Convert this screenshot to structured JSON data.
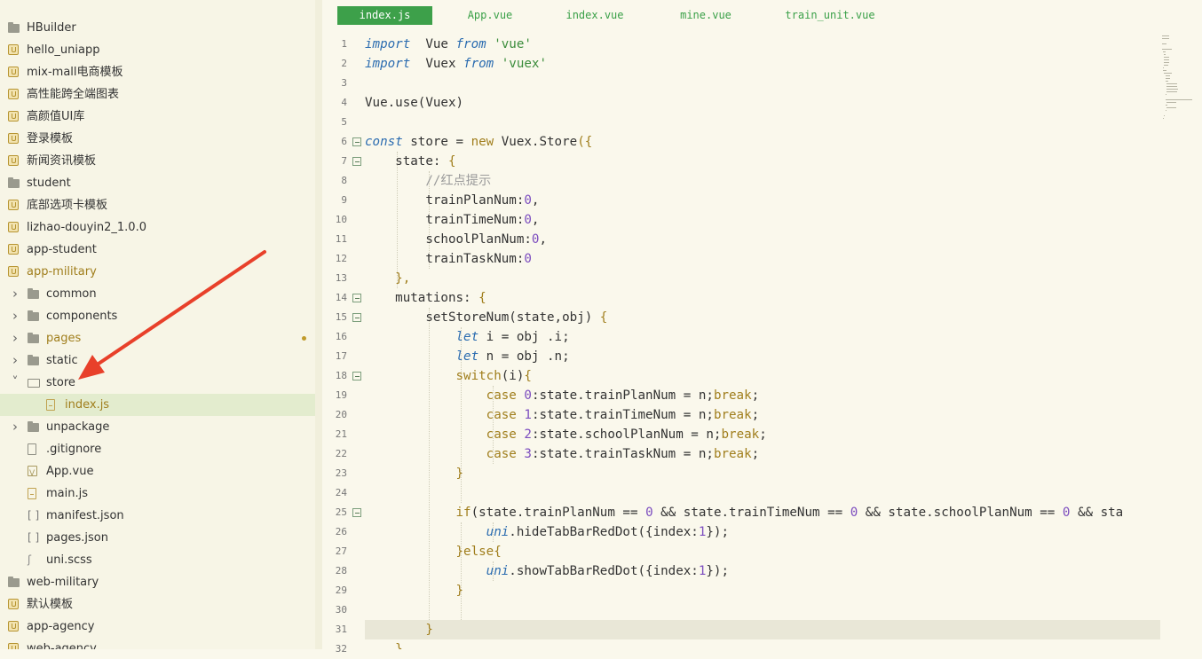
{
  "sidebar": {
    "items": [
      {
        "label": "HBuilder",
        "icon": "folder-icon",
        "indent": 0
      },
      {
        "label": "hello_uniapp",
        "icon": "uniapp-project-icon",
        "indent": 0
      },
      {
        "label": "mix-mall电商模板",
        "icon": "uniapp-project-icon",
        "indent": 0
      },
      {
        "label": "高性能跨全端图表",
        "icon": "uniapp-project-icon",
        "indent": 0
      },
      {
        "label": "高颜值UI库",
        "icon": "uniapp-project-icon",
        "indent": 0
      },
      {
        "label": "登录模板",
        "icon": "uniapp-project-icon",
        "indent": 0
      },
      {
        "label": "新闻资讯模板",
        "icon": "uniapp-project-icon",
        "indent": 0
      },
      {
        "label": "student",
        "icon": "folder-icon",
        "indent": 0
      },
      {
        "label": "底部选项卡模板",
        "icon": "uniapp-project-icon",
        "indent": 0
      },
      {
        "label": "lizhao-douyin2_1.0.0",
        "icon": "uniapp-project-icon",
        "indent": 0
      },
      {
        "label": "app-student",
        "icon": "uniapp-project-icon",
        "indent": 0
      },
      {
        "label": "app-military",
        "icon": "uniapp-project-icon",
        "indent": 0,
        "open": true
      },
      {
        "label": "common",
        "icon": "folder-icon",
        "indent": 1,
        "chevron": "right"
      },
      {
        "label": "components",
        "icon": "folder-icon",
        "indent": 1,
        "chevron": "right"
      },
      {
        "label": "pages",
        "icon": "folder-icon",
        "indent": 1,
        "chevron": "right",
        "modified": true
      },
      {
        "label": "static",
        "icon": "folder-icon",
        "indent": 1,
        "chevron": "right"
      },
      {
        "label": "store",
        "icon": "folder-open-icon",
        "indent": 1,
        "chevron": "down"
      },
      {
        "label": "index.js",
        "icon": "js-file-icon",
        "indent": 2,
        "selected": true
      },
      {
        "label": "unpackage",
        "icon": "folder-icon",
        "indent": 1,
        "chevron": "right"
      },
      {
        "label": ".gitignore",
        "icon": "file-icon",
        "indent": 1
      },
      {
        "label": "App.vue",
        "icon": "vue-file-icon",
        "indent": 1
      },
      {
        "label": "main.js",
        "icon": "js-file-icon",
        "indent": 1
      },
      {
        "label": "manifest.json",
        "icon": "json-file-icon",
        "indent": 1
      },
      {
        "label": "pages.json",
        "icon": "json-file-icon",
        "indent": 1
      },
      {
        "label": "uni.scss",
        "icon": "scss-file-icon",
        "indent": 1
      },
      {
        "label": "web-military",
        "icon": "folder-icon",
        "indent": 0
      },
      {
        "label": "默认模板",
        "icon": "uniapp-project-icon",
        "indent": 0
      },
      {
        "label": "app-agency",
        "icon": "uniapp-project-icon",
        "indent": 0
      },
      {
        "label": "web-agency",
        "icon": "uniapp-project-icon",
        "indent": 0
      }
    ]
  },
  "tabs": [
    {
      "label": "index.js",
      "active": true
    },
    {
      "label": "App.vue",
      "active": false
    },
    {
      "label": "index.vue",
      "active": false
    },
    {
      "label": "mine.vue",
      "active": false
    },
    {
      "label": "train_unit.vue",
      "active": false
    }
  ],
  "editor": {
    "line_numbers": [
      "1",
      "2",
      "3",
      "4",
      "5",
      "6",
      "7",
      "8",
      "9",
      "10",
      "11",
      "12",
      "13",
      "14",
      "15",
      "16",
      "17",
      "18",
      "19",
      "20",
      "21",
      "22",
      "23",
      "24",
      "25",
      "26",
      "27",
      "28",
      "29",
      "30",
      "31",
      "32"
    ],
    "fold_lines": [
      6,
      7,
      14,
      15,
      18,
      25
    ],
    "highlighted_line": 31,
    "lines": [
      [
        [
          "kw",
          "import"
        ],
        [
          "",
          "  Vue "
        ],
        [
          "kw",
          "from"
        ],
        [
          "str",
          " 'vue'"
        ]
      ],
      [
        [
          "kw",
          "import"
        ],
        [
          "",
          "  Vuex "
        ],
        [
          "kw",
          "from"
        ],
        [
          "str",
          " 'vuex'"
        ]
      ],
      [],
      [
        [
          "",
          "Vue.use(Vuex)"
        ]
      ],
      [],
      [
        [
          "kw",
          "const"
        ],
        [
          "",
          " store = "
        ],
        [
          "kw2",
          "new"
        ],
        [
          "",
          " Vuex.Store"
        ],
        [
          "bk",
          "({"
        ]
      ],
      [
        [
          "",
          "    state: "
        ],
        [
          "bk",
          "{"
        ]
      ],
      [
        [
          "cm",
          "        //红点提示"
        ]
      ],
      [
        [
          "",
          "        trainPlanNum:"
        ],
        [
          "num",
          "0"
        ],
        [
          "",
          ","
        ]
      ],
      [
        [
          "",
          "        trainTimeNum:"
        ],
        [
          "num",
          "0"
        ],
        [
          "",
          ","
        ]
      ],
      [
        [
          "",
          "        schoolPlanNum:"
        ],
        [
          "num",
          "0"
        ],
        [
          "",
          ","
        ]
      ],
      [
        [
          "",
          "        trainTaskNum:"
        ],
        [
          "num",
          "0"
        ]
      ],
      [
        [
          "bk",
          "    },"
        ]
      ],
      [
        [
          "",
          "    mutations: "
        ],
        [
          "bk",
          "{"
        ]
      ],
      [
        [
          "",
          "        setStoreNum(state,obj) "
        ],
        [
          "bk",
          "{"
        ]
      ],
      [
        [
          "kw",
          "            let"
        ],
        [
          "",
          " i = obj .i;"
        ]
      ],
      [
        [
          "kw",
          "            let"
        ],
        [
          "",
          " n = obj .n;"
        ]
      ],
      [
        [
          "kw2",
          "            switch"
        ],
        [
          "",
          "(i)"
        ],
        [
          "bk",
          "{"
        ]
      ],
      [
        [
          "kw2",
          "                case"
        ],
        [
          "num",
          " 0"
        ],
        [
          "",
          ":state.trainPlanNum = n;"
        ],
        [
          "kw2",
          "break"
        ],
        [
          "",
          ";"
        ]
      ],
      [
        [
          "kw2",
          "                case"
        ],
        [
          "num",
          " 1"
        ],
        [
          "",
          ":state.trainTimeNum = n;"
        ],
        [
          "kw2",
          "break"
        ],
        [
          "",
          ";"
        ]
      ],
      [
        [
          "kw2",
          "                case"
        ],
        [
          "num",
          " 2"
        ],
        [
          "",
          ":state.schoolPlanNum = n;"
        ],
        [
          "kw2",
          "break"
        ],
        [
          "",
          ";"
        ]
      ],
      [
        [
          "kw2",
          "                case"
        ],
        [
          "num",
          " 3"
        ],
        [
          "",
          ":state.trainTaskNum = n;"
        ],
        [
          "kw2",
          "break"
        ],
        [
          "",
          ";"
        ]
      ],
      [
        [
          "bk",
          "            }"
        ]
      ],
      [],
      [
        [
          "kw2",
          "            if"
        ],
        [
          "",
          "(state.trainPlanNum == "
        ],
        [
          "num",
          "0"
        ],
        [
          "",
          " && state.trainTimeNum == "
        ],
        [
          "num",
          "0"
        ],
        [
          "",
          " && state.schoolPlanNum == "
        ],
        [
          "num",
          "0"
        ],
        [
          "",
          " && sta"
        ]
      ],
      [
        [
          "uni",
          "                uni"
        ],
        [
          "",
          ".hideTabBarRedDot({index:"
        ],
        [
          "num",
          "1"
        ],
        [
          "",
          "});"
        ]
      ],
      [
        [
          "bk",
          "            }"
        ],
        [
          "kw2",
          "else"
        ],
        [
          "bk",
          "{"
        ]
      ],
      [
        [
          "uni",
          "                uni"
        ],
        [
          "",
          ".showTabBarRedDot({index:"
        ],
        [
          "num",
          "1"
        ],
        [
          "",
          "});"
        ]
      ],
      [
        [
          "bk",
          "            }"
        ]
      ],
      [],
      [
        [
          "bk",
          "        }"
        ]
      ],
      [
        [
          "bk",
          "    }"
        ]
      ]
    ]
  },
  "colors": {
    "accent": "#3da04a",
    "sidebar_bg": "#f7f5e6",
    "editor_bg": "#faf8ec",
    "selection": "#e3ecce",
    "annotation_arrow": "#e8402a"
  }
}
